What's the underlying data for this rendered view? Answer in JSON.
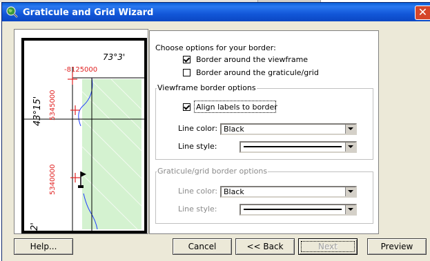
{
  "window": {
    "title": "Graticule and Grid Wizard",
    "icon": "globe-magnifier-icon",
    "close_icon": "close-icon"
  },
  "preview": {
    "longitude_label": "73°3'",
    "easting_label": "-8125000",
    "latitude_label": "43°15'",
    "northing_label_1": "5345000",
    "northing_label_2": "5340000",
    "bottom_label": "2'"
  },
  "options": {
    "heading": "Choose options for your border:",
    "border_viewframe": {
      "label": "Border around the viewframe",
      "checked": true
    },
    "border_graticule": {
      "label": "Border around the graticule/grid",
      "checked": false
    }
  },
  "viewframe_group": {
    "title": "Viewframe border options",
    "align_labels": {
      "label": "Align labels to border",
      "checked": true
    },
    "line_color_label": "Line color:",
    "line_color_value": "Black",
    "line_style_label": "Line style:"
  },
  "graticule_group": {
    "title": "Graticule/grid border options",
    "line_color_label": "Line color:",
    "line_color_value": "Black",
    "line_style_label": "Line style:"
  },
  "buttons": {
    "help": "Help...",
    "cancel": "Cancel",
    "back": "<< Back",
    "next": "Next",
    "preview": "Preview"
  }
}
